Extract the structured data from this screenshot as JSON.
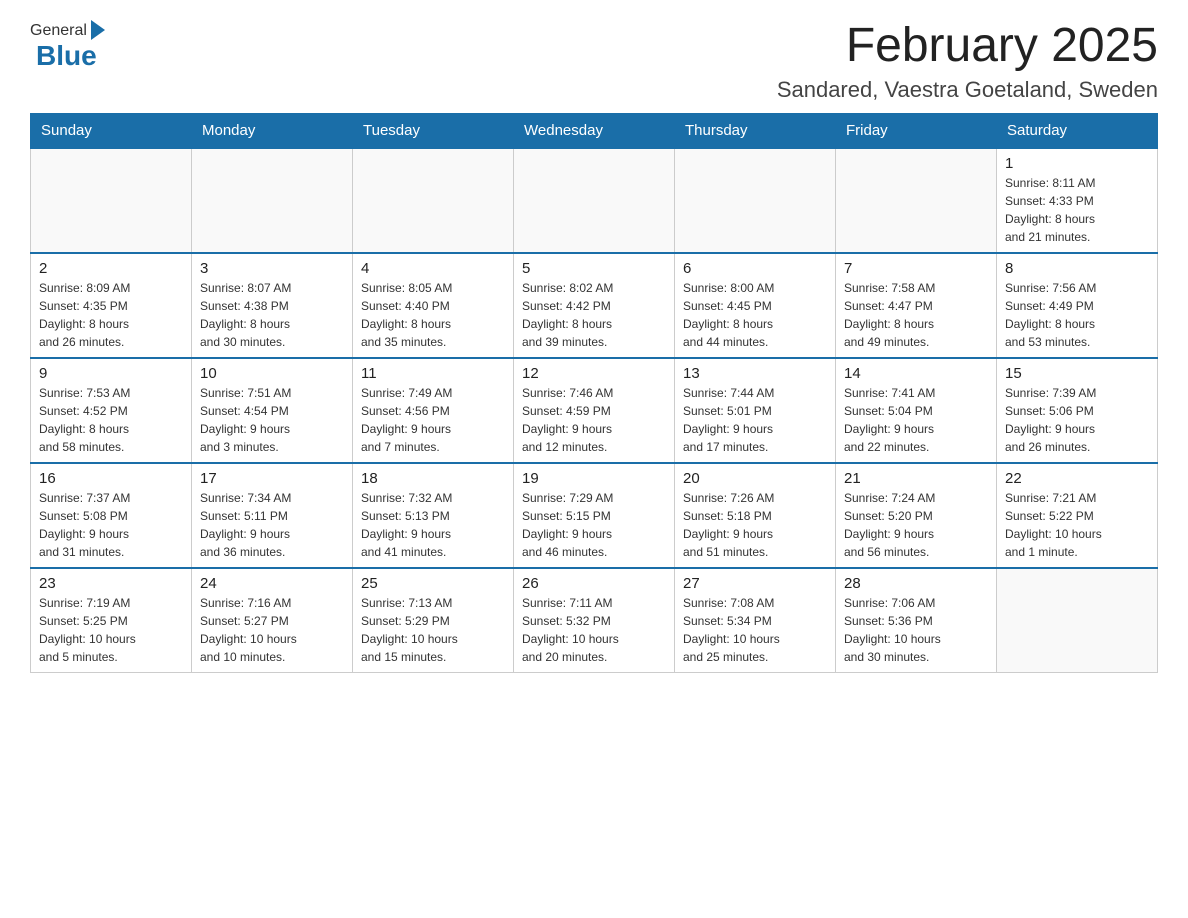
{
  "header": {
    "logo": {
      "general": "General",
      "blue": "Blue",
      "arrow_color": "#1a6ea8"
    },
    "title": "February 2025",
    "location": "Sandared, Vaestra Goetaland, Sweden"
  },
  "calendar": {
    "days_of_week": [
      "Sunday",
      "Monday",
      "Tuesday",
      "Wednesday",
      "Thursday",
      "Friday",
      "Saturday"
    ],
    "weeks": [
      [
        {
          "day": "",
          "info": ""
        },
        {
          "day": "",
          "info": ""
        },
        {
          "day": "",
          "info": ""
        },
        {
          "day": "",
          "info": ""
        },
        {
          "day": "",
          "info": ""
        },
        {
          "day": "",
          "info": ""
        },
        {
          "day": "1",
          "info": "Sunrise: 8:11 AM\nSunset: 4:33 PM\nDaylight: 8 hours\nand 21 minutes."
        }
      ],
      [
        {
          "day": "2",
          "info": "Sunrise: 8:09 AM\nSunset: 4:35 PM\nDaylight: 8 hours\nand 26 minutes."
        },
        {
          "day": "3",
          "info": "Sunrise: 8:07 AM\nSunset: 4:38 PM\nDaylight: 8 hours\nand 30 minutes."
        },
        {
          "day": "4",
          "info": "Sunrise: 8:05 AM\nSunset: 4:40 PM\nDaylight: 8 hours\nand 35 minutes."
        },
        {
          "day": "5",
          "info": "Sunrise: 8:02 AM\nSunset: 4:42 PM\nDaylight: 8 hours\nand 39 minutes."
        },
        {
          "day": "6",
          "info": "Sunrise: 8:00 AM\nSunset: 4:45 PM\nDaylight: 8 hours\nand 44 minutes."
        },
        {
          "day": "7",
          "info": "Sunrise: 7:58 AM\nSunset: 4:47 PM\nDaylight: 8 hours\nand 49 minutes."
        },
        {
          "day": "8",
          "info": "Sunrise: 7:56 AM\nSunset: 4:49 PM\nDaylight: 8 hours\nand 53 minutes."
        }
      ],
      [
        {
          "day": "9",
          "info": "Sunrise: 7:53 AM\nSunset: 4:52 PM\nDaylight: 8 hours\nand 58 minutes."
        },
        {
          "day": "10",
          "info": "Sunrise: 7:51 AM\nSunset: 4:54 PM\nDaylight: 9 hours\nand 3 minutes."
        },
        {
          "day": "11",
          "info": "Sunrise: 7:49 AM\nSunset: 4:56 PM\nDaylight: 9 hours\nand 7 minutes."
        },
        {
          "day": "12",
          "info": "Sunrise: 7:46 AM\nSunset: 4:59 PM\nDaylight: 9 hours\nand 12 minutes."
        },
        {
          "day": "13",
          "info": "Sunrise: 7:44 AM\nSunset: 5:01 PM\nDaylight: 9 hours\nand 17 minutes."
        },
        {
          "day": "14",
          "info": "Sunrise: 7:41 AM\nSunset: 5:04 PM\nDaylight: 9 hours\nand 22 minutes."
        },
        {
          "day": "15",
          "info": "Sunrise: 7:39 AM\nSunset: 5:06 PM\nDaylight: 9 hours\nand 26 minutes."
        }
      ],
      [
        {
          "day": "16",
          "info": "Sunrise: 7:37 AM\nSunset: 5:08 PM\nDaylight: 9 hours\nand 31 minutes."
        },
        {
          "day": "17",
          "info": "Sunrise: 7:34 AM\nSunset: 5:11 PM\nDaylight: 9 hours\nand 36 minutes."
        },
        {
          "day": "18",
          "info": "Sunrise: 7:32 AM\nSunset: 5:13 PM\nDaylight: 9 hours\nand 41 minutes."
        },
        {
          "day": "19",
          "info": "Sunrise: 7:29 AM\nSunset: 5:15 PM\nDaylight: 9 hours\nand 46 minutes."
        },
        {
          "day": "20",
          "info": "Sunrise: 7:26 AM\nSunset: 5:18 PM\nDaylight: 9 hours\nand 51 minutes."
        },
        {
          "day": "21",
          "info": "Sunrise: 7:24 AM\nSunset: 5:20 PM\nDaylight: 9 hours\nand 56 minutes."
        },
        {
          "day": "22",
          "info": "Sunrise: 7:21 AM\nSunset: 5:22 PM\nDaylight: 10 hours\nand 1 minute."
        }
      ],
      [
        {
          "day": "23",
          "info": "Sunrise: 7:19 AM\nSunset: 5:25 PM\nDaylight: 10 hours\nand 5 minutes."
        },
        {
          "day": "24",
          "info": "Sunrise: 7:16 AM\nSunset: 5:27 PM\nDaylight: 10 hours\nand 10 minutes."
        },
        {
          "day": "25",
          "info": "Sunrise: 7:13 AM\nSunset: 5:29 PM\nDaylight: 10 hours\nand 15 minutes."
        },
        {
          "day": "26",
          "info": "Sunrise: 7:11 AM\nSunset: 5:32 PM\nDaylight: 10 hours\nand 20 minutes."
        },
        {
          "day": "27",
          "info": "Sunrise: 7:08 AM\nSunset: 5:34 PM\nDaylight: 10 hours\nand 25 minutes."
        },
        {
          "day": "28",
          "info": "Sunrise: 7:06 AM\nSunset: 5:36 PM\nDaylight: 10 hours\nand 30 minutes."
        },
        {
          "day": "",
          "info": ""
        }
      ]
    ]
  }
}
